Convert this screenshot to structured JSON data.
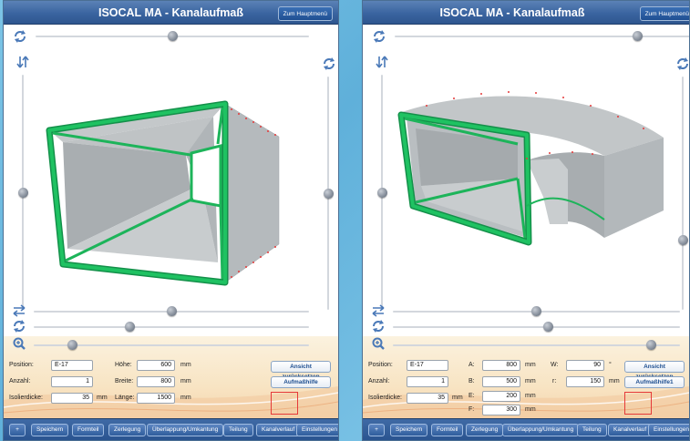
{
  "colors": {
    "titlebar": "#3a64a0",
    "duct_flange": "#1db45a",
    "duct_body": "#b9bdbf",
    "accent_red": "#e53939"
  },
  "left": {
    "title": "ISOCAL MA - Kanalaufmaß",
    "menu_button": "Zum Hauptmenü",
    "view_icons": [
      "rotate-icon",
      "flip-vertical-icon",
      "rotate-icon",
      "swap-horizontal-icon",
      "rotate-icon",
      "zoom-icon"
    ],
    "sliders": {
      "top_rotation": 0.5,
      "left_vertical": 0.5,
      "right_vertical": 0.5,
      "horizontal_shift": 0.5,
      "rotation": 0.35,
      "zoom": 0.14
    },
    "form": {
      "position_label": "Position:",
      "position_value": "E-17",
      "anzahl_label": "Anzahl:",
      "anzahl_value": "1",
      "isolier_label": "Isolierdicke:",
      "isolier_value": "35",
      "isolier_unit": "mm",
      "hoehe_label": "Höhe:",
      "hoehe_value": "600",
      "hoehe_unit": "mm",
      "breite_label": "Breite:",
      "breite_value": "800",
      "breite_unit": "mm",
      "laenge_label": "Länge:",
      "laenge_value": "1500",
      "laenge_unit": "mm",
      "reset_button": "Ansicht zurücksetzen",
      "help_button": "Aufmaßhilfe"
    },
    "toolbar": [
      "+",
      "Speichern",
      "Formteil",
      "Zerlegung",
      "Überlappung/Umkantung",
      "Teilung",
      "Kanalverlauf",
      "Einstellungen"
    ]
  },
  "right": {
    "title": "ISOCAL MA - Kanalaufmaß",
    "menu_button": "Zum Hauptmenü",
    "sliders": {
      "top_rotation": 0.82,
      "left_vertical": 0.5,
      "right_vertical": 0.7,
      "horizontal_shift": 0.5,
      "rotation": 0.54,
      "zoom": 0.9
    },
    "form": {
      "position_label": "Position:",
      "position_value": "E-17",
      "anzahl_label": "Anzahl:",
      "anzahl_value": "1",
      "isolier_label": "Isolierdicke:",
      "isolier_value": "35",
      "isolier_unit": "mm",
      "a_label": "A:",
      "a_value": "800",
      "a_unit": "mm",
      "b_label": "B:",
      "b_value": "500",
      "b_unit": "mm",
      "e_label": "E:",
      "e_value": "200",
      "e_unit": "mm",
      "f_label": "F:",
      "f_value": "300",
      "f_unit": "mm",
      "w_label": "W:",
      "w_value": "90",
      "w_unit": "°",
      "r_label": "r:",
      "r_value": "150",
      "r_unit": "mm",
      "reset_button": "Ansicht zurücksetzen",
      "help_button": "Aufmaßhilfe1"
    },
    "toolbar": [
      "+",
      "Speichern",
      "Formteil",
      "Zerlegung",
      "Überlappung/Umkantung",
      "Teilung",
      "Kanalverlauf",
      "Einstellungen"
    ]
  }
}
